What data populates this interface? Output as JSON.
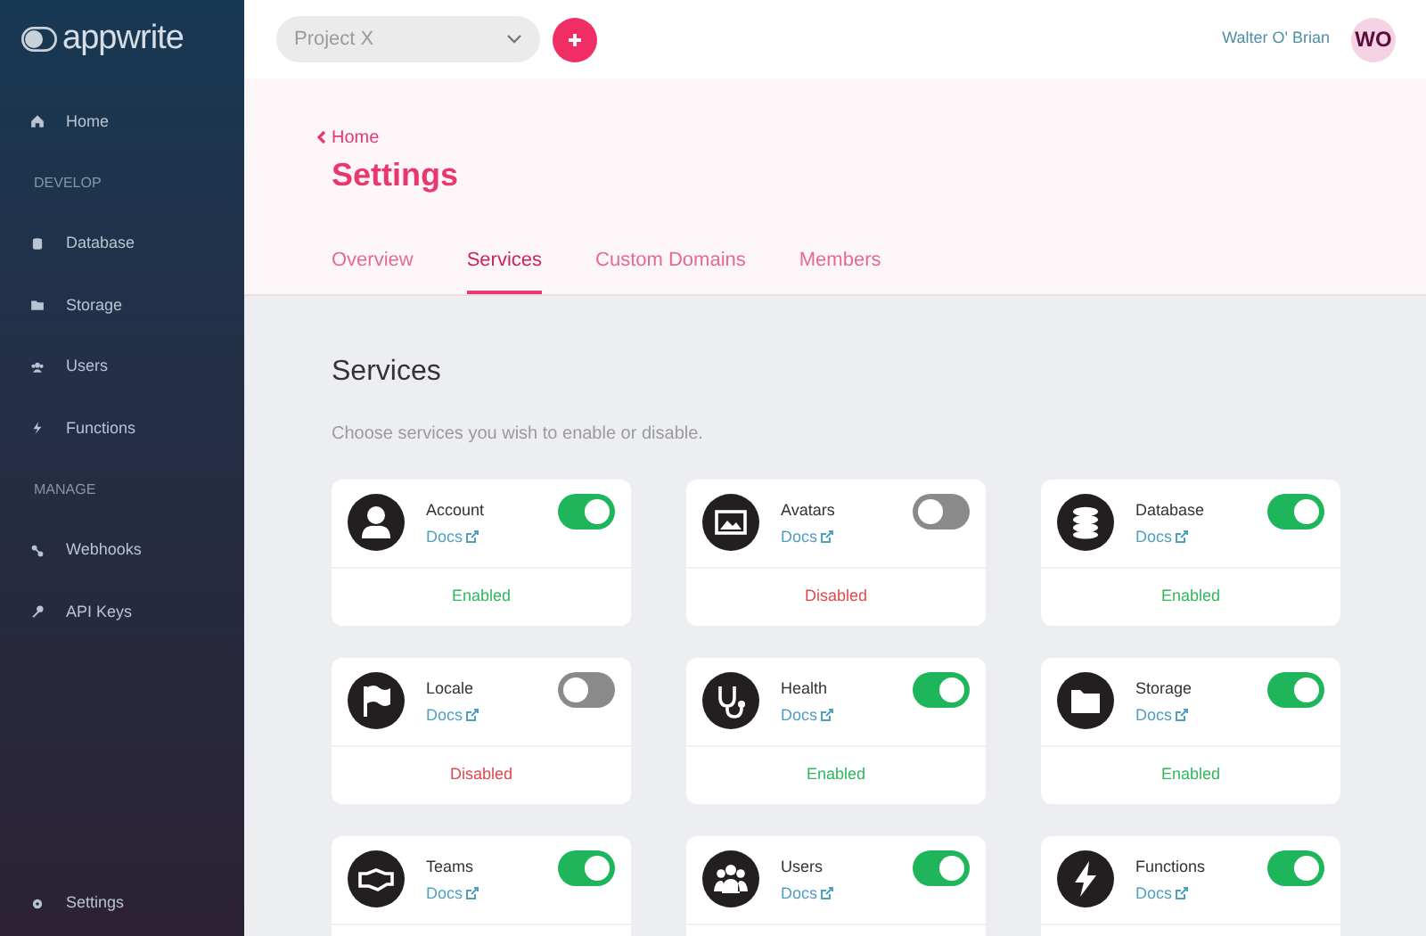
{
  "sidebar": {
    "logo": "appwrite",
    "items": [
      {
        "kind": "link",
        "label": "Home"
      },
      {
        "kind": "section",
        "label": "DEVELOP"
      },
      {
        "kind": "link",
        "label": "Database"
      },
      {
        "kind": "link",
        "label": "Storage"
      },
      {
        "kind": "link",
        "label": "Users"
      },
      {
        "kind": "link",
        "label": "Functions"
      },
      {
        "kind": "section",
        "label": "MANAGE"
      },
      {
        "kind": "link",
        "label": "Webhooks"
      },
      {
        "kind": "link",
        "label": "API Keys"
      }
    ],
    "footer_item": "Settings"
  },
  "topbar": {
    "project": "Project X",
    "user_name": "Walter O' Brian",
    "avatar_initials": "WO"
  },
  "header": {
    "back_link": "Home",
    "title": "Settings",
    "tabs": [
      {
        "label": "Overview",
        "selected": false
      },
      {
        "label": "Services",
        "selected": true
      },
      {
        "label": "Custom Domains",
        "selected": false
      },
      {
        "label": "Members",
        "selected": false
      }
    ]
  },
  "content": {
    "heading": "Services",
    "description": "Choose services you wish to enable or disable.",
    "services": [
      {
        "name": "Account",
        "docs": "Docs",
        "on": true,
        "status": "Enabled"
      },
      {
        "name": "Avatars",
        "docs": "Docs",
        "on": false,
        "status": "Disabled"
      },
      {
        "name": "Database",
        "docs": "Docs",
        "on": true,
        "status": "Enabled"
      },
      {
        "name": "Locale",
        "docs": "Docs",
        "on": false,
        "status": "Disabled"
      },
      {
        "name": "Health",
        "docs": "Docs",
        "on": true,
        "status": "Enabled"
      },
      {
        "name": "Storage",
        "docs": "Docs",
        "on": true,
        "status": "Enabled"
      },
      {
        "name": "Teams",
        "docs": "Docs",
        "on": true
      },
      {
        "name": "Users",
        "docs": "Docs",
        "on": true
      },
      {
        "name": "Functions",
        "docs": "Docs",
        "on": true
      }
    ]
  }
}
